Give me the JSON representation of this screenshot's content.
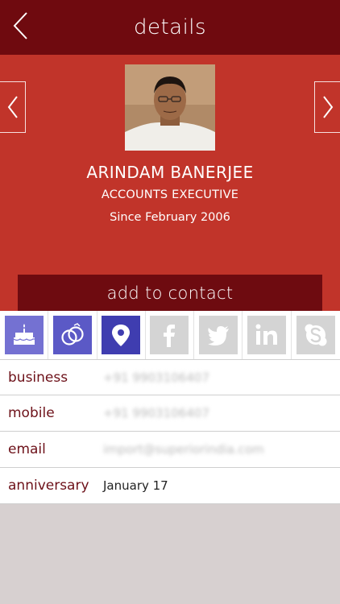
{
  "header": {
    "title": "details"
  },
  "profile": {
    "name": "ARINDAM BANERJEE",
    "role": "ACCOUNTS EXECUTIVE",
    "since": "Since February 2006",
    "add_button_label": "add to contact"
  },
  "tiles": [
    {
      "name": "birthday-cake-icon",
      "state": "active-light"
    },
    {
      "name": "rings-icon",
      "state": "active"
    },
    {
      "name": "location-pin-icon",
      "state": "active-dark"
    },
    {
      "name": "facebook-icon",
      "state": "disabled"
    },
    {
      "name": "twitter-icon",
      "state": "disabled"
    },
    {
      "name": "linkedin-icon",
      "state": "disabled"
    },
    {
      "name": "skype-icon",
      "state": "disabled"
    }
  ],
  "details": [
    {
      "label": "business",
      "value": "+91 9903106407",
      "blurred": true
    },
    {
      "label": "mobile",
      "value": "+91 9903106407",
      "blurred": true
    },
    {
      "label": "email",
      "value": "import@superiorindia.com",
      "blurred": true
    },
    {
      "label": "anniversary",
      "value": "January 17",
      "blurred": false
    }
  ],
  "colors": {
    "topbar": "#6f0a0f",
    "hero": "#c1342a",
    "button": "#6e0b10",
    "label": "#6d1119"
  }
}
